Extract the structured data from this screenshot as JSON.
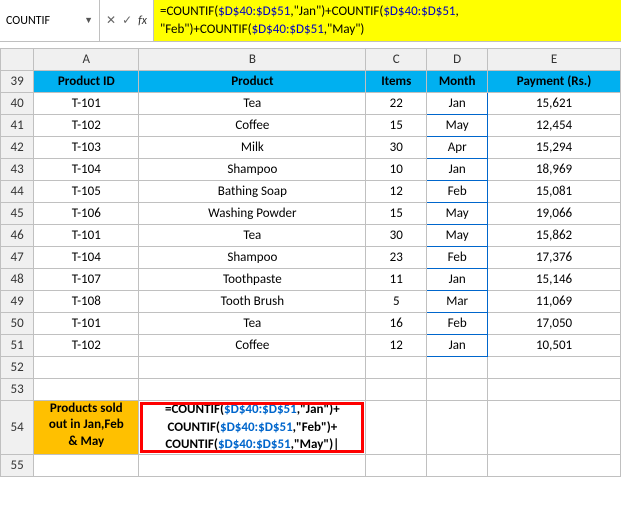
{
  "namebox": {
    "value": "COUNTIF",
    "dropdown": "▼"
  },
  "fx_icons": {
    "cancel": "✕",
    "enter": "✓",
    "fx": "fx"
  },
  "formula_bar": {
    "p1": "=COUNTIF(",
    "r1": "$D$40:$D$51",
    "p2": ",\"Jan\")+COUNTIF(",
    "r2": "$D$40:$D$51",
    "p3": ",",
    "line2a": "\"Feb\")+COUNTIF(",
    "r3": "$D$40:$D$51",
    "line2b": ",\"May\")"
  },
  "cols": {
    "A": "A",
    "B": "B",
    "C": "C",
    "D": "D",
    "E": "E"
  },
  "rows": {
    "r39": "39",
    "r40": "40",
    "r41": "41",
    "r42": "42",
    "r43": "43",
    "r44": "44",
    "r45": "45",
    "r46": "46",
    "r47": "47",
    "r48": "48",
    "r49": "49",
    "r50": "50",
    "r51": "51",
    "r52": "52",
    "r53": "53",
    "r54": "54",
    "r55": "55"
  },
  "headers": {
    "pid": "Product ID",
    "product": "Product",
    "items": "Items",
    "month": "Month",
    "payment": "Payment (Rs.)"
  },
  "data": [
    {
      "pid": "T-101",
      "product": "Tea",
      "items": "22",
      "month": "Jan",
      "pay": "15,621"
    },
    {
      "pid": "T-102",
      "product": "Coffee",
      "items": "15",
      "month": "May",
      "pay": "12,454"
    },
    {
      "pid": "T-103",
      "product": "Milk",
      "items": "30",
      "month": "Apr",
      "pay": "15,294"
    },
    {
      "pid": "T-104",
      "product": "Shampoo",
      "items": "10",
      "month": "Jan",
      "pay": "18,969"
    },
    {
      "pid": "T-105",
      "product": "Bathing Soap",
      "items": "12",
      "month": "Feb",
      "pay": "15,081"
    },
    {
      "pid": "T-106",
      "product": "Washing Powder",
      "items": "15",
      "month": "May",
      "pay": "19,066"
    },
    {
      "pid": "T-101",
      "product": "Tea",
      "items": "30",
      "month": "May",
      "pay": "15,862"
    },
    {
      "pid": "T-104",
      "product": "Shampoo",
      "items": "23",
      "month": "Feb",
      "pay": "17,376"
    },
    {
      "pid": "T-107",
      "product": "Toothpaste",
      "items": "11",
      "month": "Jan",
      "pay": "15,146"
    },
    {
      "pid": "T-108",
      "product": "Tooth Brush",
      "items": "5",
      "month": "Mar",
      "pay": "11,069"
    },
    {
      "pid": "T-101",
      "product": "Tea",
      "items": "16",
      "month": "Feb",
      "pay": "17,050"
    },
    {
      "pid": "T-102",
      "product": "Coffee",
      "items": "12",
      "month": "Jan",
      "pay": "10,501"
    }
  ],
  "summary": {
    "label_l1": "Products sold",
    "label_l2": "out in Jan,Feb",
    "label_l3": "& May",
    "f_l1a": "=COUNTIF(",
    "f_r1": "$D$40:$D$51",
    "f_l1b": ",\"Jan\")+",
    "f_l2a": "COUNTIF(",
    "f_r2": "$D$40:$D$51",
    "f_l2b": ",\"Feb\")+",
    "f_l3a": "COUNTIF(",
    "f_r3": "$D$40:$D$51",
    "f_l3b": ",\"May\")|"
  }
}
